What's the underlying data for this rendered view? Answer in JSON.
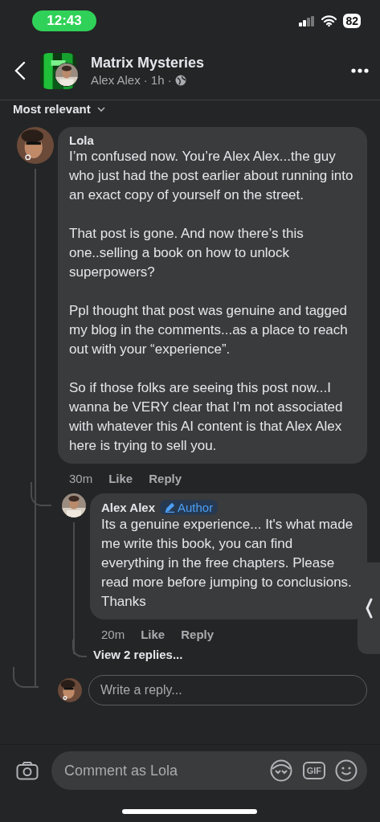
{
  "status_bar": {
    "time": "12:43",
    "battery": "82"
  },
  "header": {
    "title": "Matrix Mysteries",
    "author": "Alex Alex",
    "meta": "· 1h ·"
  },
  "sort": {
    "label": "Most relevant"
  },
  "comments": [
    {
      "author": "Lola",
      "text": "I’m confused now. You’re Alex Alex...the guy who just had the post earlier about running into an exact copy of yourself on the street.\n\nThat post is gone. And now there’s this one..selling a book on how to unlock superpowers?\n\nPpl thought that post was genuine and tagged my blog in the comments...as a place to reach out with your “experience”.\n\nSo if those folks are seeing this post now...I wanna be VERY clear that I’m not associated with whatever this AI content is that Alex Alex here is trying to sell you.",
      "time": "30m",
      "actions": [
        "Like",
        "Reply"
      ],
      "replies": [
        {
          "author": "Alex Alex",
          "badge": "Author",
          "text": "Its a genuine experience... It's what made me write this book, you can find everything in the free chapters. Please read more before jumping to conclusions. Thanks",
          "time": "20m",
          "actions": [
            "Like",
            "Reply"
          ],
          "more": "View 2 replies..."
        }
      ],
      "reply_field": {
        "placeholder": "Write a reply..."
      }
    }
  ],
  "composer": {
    "placeholder": "Comment as Lola",
    "gif": "GIF"
  }
}
